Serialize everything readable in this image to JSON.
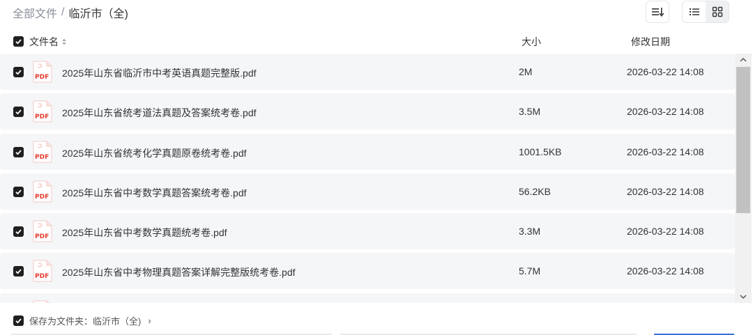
{
  "breadcrumb": {
    "root": "全部文件",
    "separator": "/",
    "current": "临沂市（全)"
  },
  "toolbar": {
    "sort_icon": "sort-list-icon",
    "list_view_icon": "list-view-icon",
    "grid_view_icon": "grid-view-icon"
  },
  "header": {
    "name": "文件名",
    "size": "大小",
    "date": "修改日期"
  },
  "files": [
    {
      "name": "2025年山东省临沂市中考英语真题完整版.pdf",
      "size": "2M",
      "date": "2026-03-22 14:08"
    },
    {
      "name": "2025年山东省统考道法真题及答案统考卷.pdf",
      "size": "3.5M",
      "date": "2026-03-22 14:08"
    },
    {
      "name": "2025年山东省统考化学真题原卷统考卷.pdf",
      "size": "1001.5KB",
      "date": "2026-03-22 14:08"
    },
    {
      "name": "2025年山东省中考数学真题答案统考卷.pdf",
      "size": "56.2KB",
      "date": "2026-03-22 14:08"
    },
    {
      "name": "2025年山东省中考数学真题统考卷.pdf",
      "size": "3.3M",
      "date": "2026-03-22 14:08"
    },
    {
      "name": "2025年山东省中考物理真题答案详解完整版统考卷.pdf",
      "size": "5.7M",
      "date": "2026-03-22 14:08"
    },
    {
      "name": "",
      "size": "",
      "date": ""
    }
  ],
  "file_icon_label": "PDF",
  "footer": {
    "save_label": "保存为文件夹：临沂市（全)",
    "chevron": "›"
  },
  "colors": {
    "checkbox": "#1f1f1f",
    "row_bg": "#f5f6f8",
    "pdf_red": "#e23b2e",
    "muted": "#8a8f99"
  }
}
